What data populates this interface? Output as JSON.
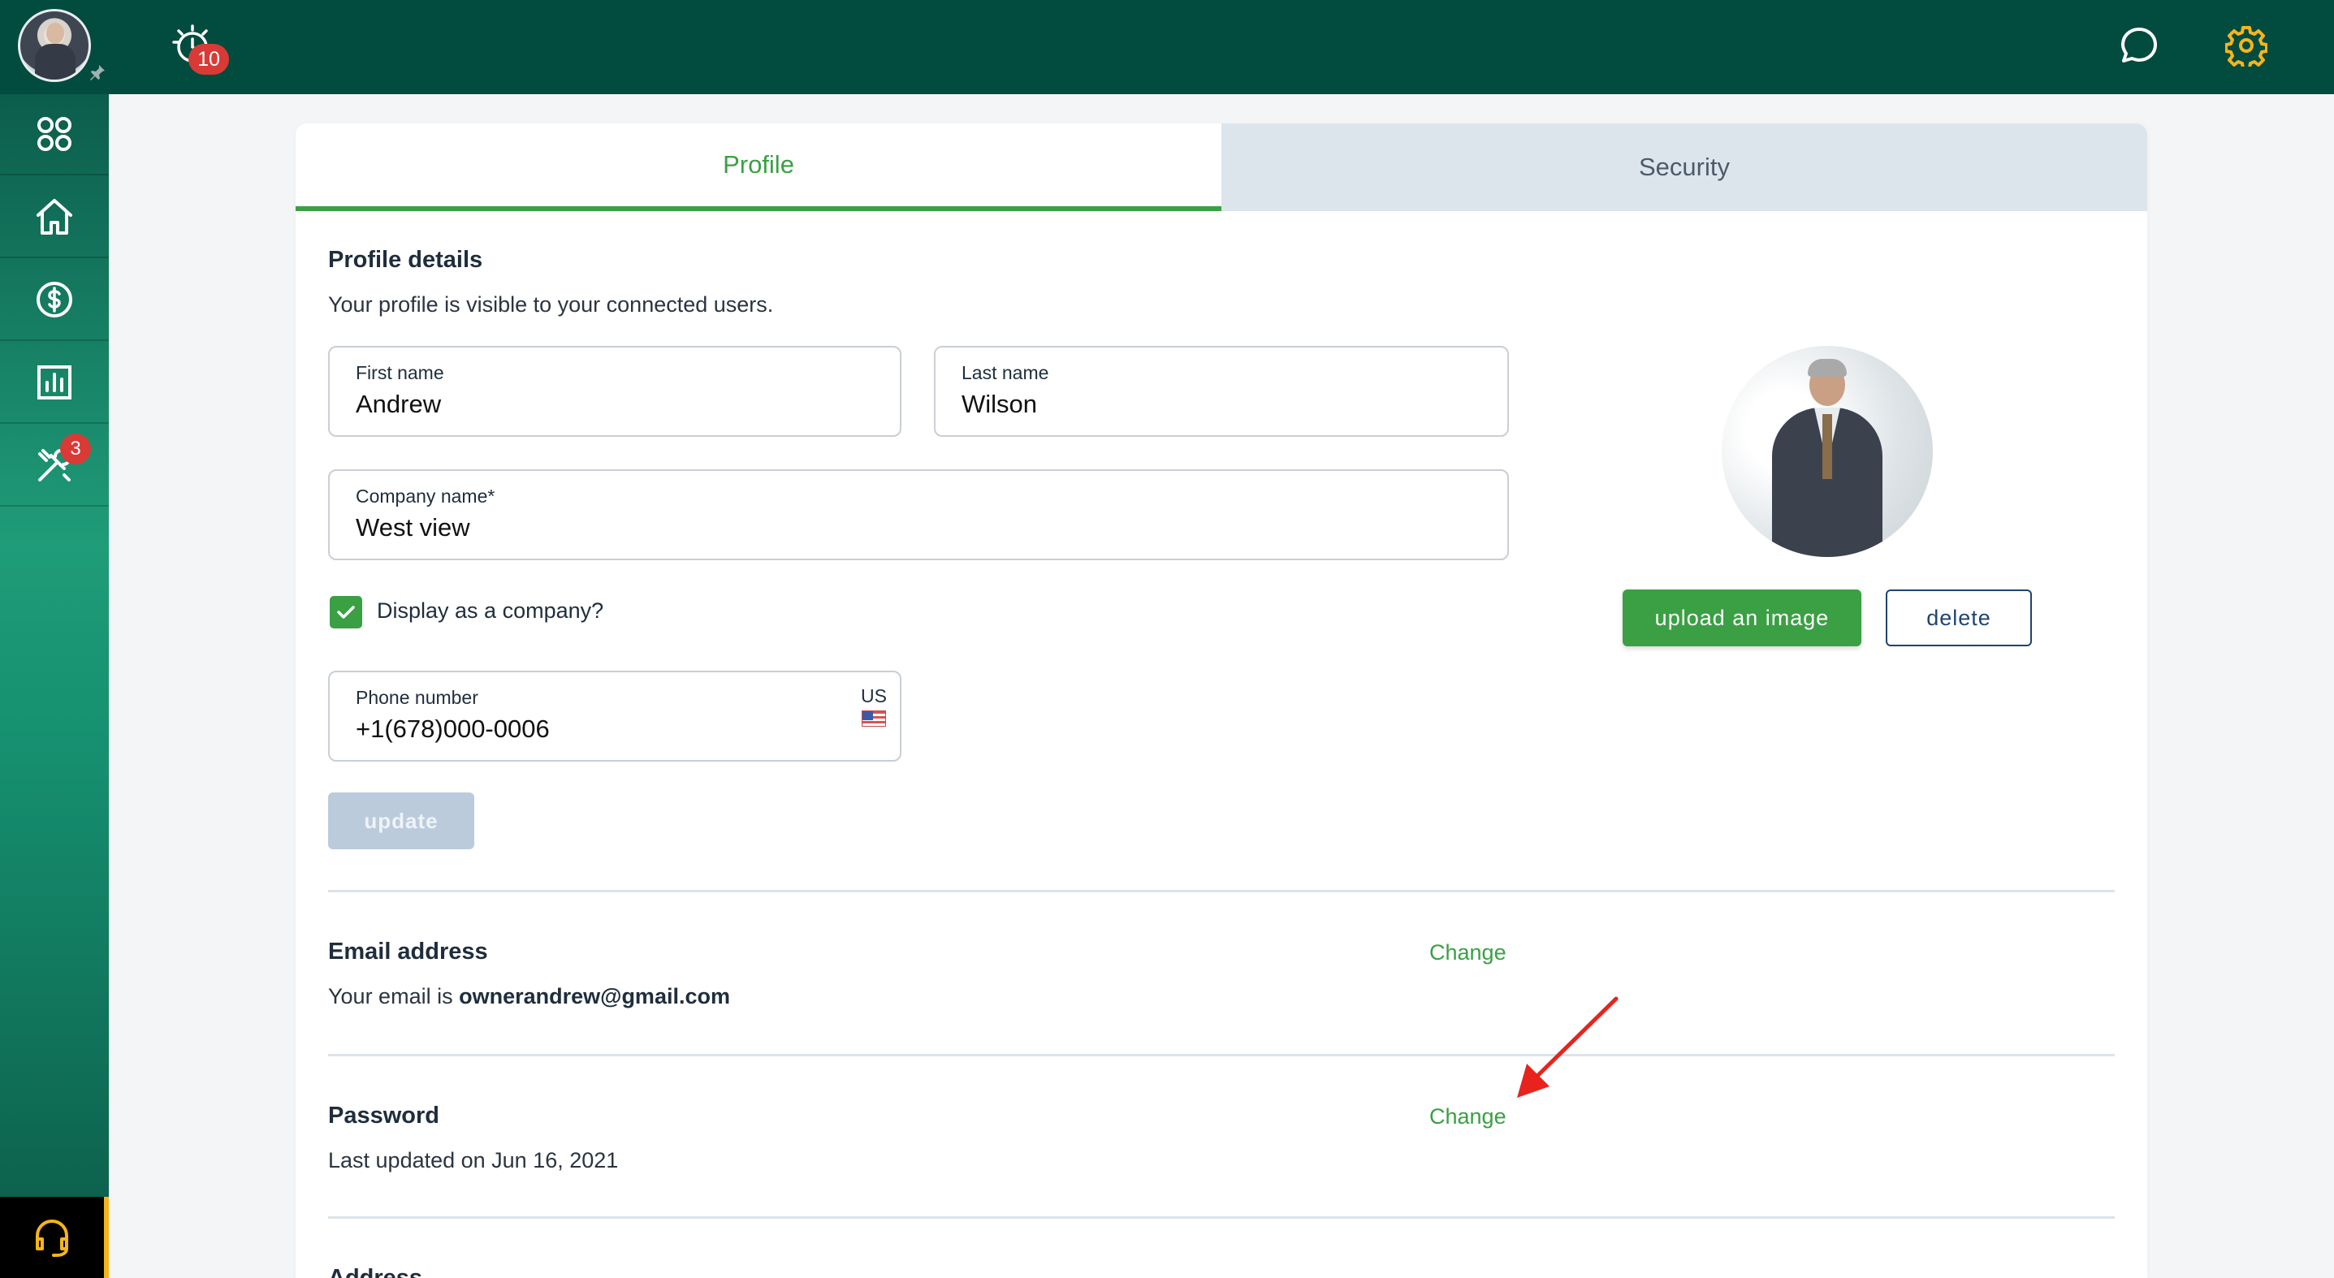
{
  "topbar": {
    "notification_count": "10",
    "icons": [
      "avatar",
      "pin-icon",
      "alarm-icon",
      "chat-icon",
      "gear-icon"
    ]
  },
  "sidebar": {
    "items": [
      {
        "icon": "grid-icon"
      },
      {
        "icon": "home-icon"
      },
      {
        "icon": "dollar-icon"
      },
      {
        "icon": "chart-icon"
      },
      {
        "icon": "tools-icon",
        "badge": "3"
      }
    ],
    "support_icon": "headset-icon"
  },
  "tabs": {
    "profile": "Profile",
    "security": "Security"
  },
  "profile": {
    "title": "Profile details",
    "subtitle": "Your profile is visible to your connected users.",
    "first_name_label": "First name",
    "first_name": "Andrew",
    "last_name_label": "Last name",
    "last_name": "Wilson",
    "company_label": "Company name*",
    "company": "West view",
    "display_company_label": "Display as a company?",
    "display_company_checked": true,
    "phone_label": "Phone number",
    "phone": "+1(678)000-0006",
    "country": "US",
    "update_label": "update",
    "upload_label": "upload an image",
    "delete_label": "delete"
  },
  "email": {
    "title": "Email address",
    "prefix": "Your email is ",
    "value": "ownerandrew@gmail.com",
    "change_label": "Change"
  },
  "password": {
    "title": "Password",
    "last_updated": "Last updated on Jun 16, 2021",
    "change_label": "Change"
  },
  "address": {
    "title": "Address"
  },
  "colors": {
    "topbar": "#024b3f",
    "accent": "#3aa043",
    "badge": "#d93a35",
    "gear": "#f6b41c",
    "annotation_arrow": "#e8231d"
  }
}
